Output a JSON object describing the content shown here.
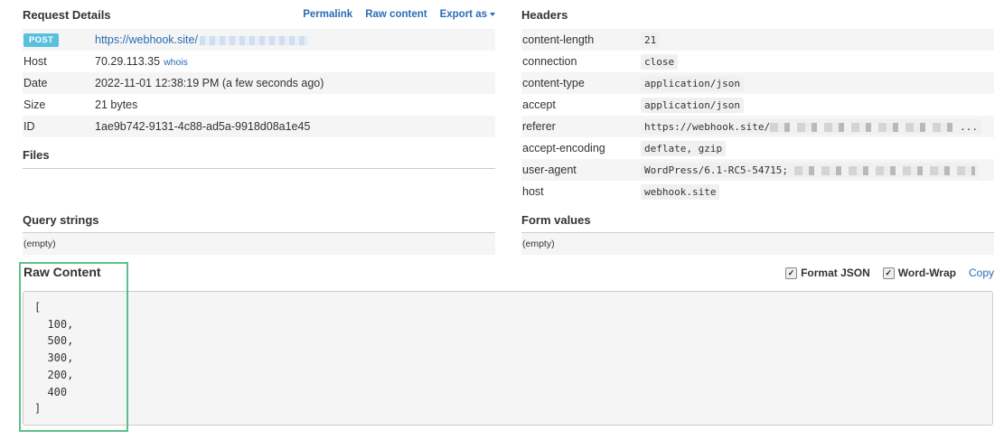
{
  "request": {
    "title": "Request Details",
    "links": {
      "permalink": "Permalink",
      "raw": "Raw content",
      "export": "Export as"
    },
    "method": "POST",
    "url": "https://webhook.site/",
    "rows": [
      {
        "key": "Host",
        "value": "70.29.113.35",
        "extra": "whois"
      },
      {
        "key": "Date",
        "value": "2022-11-01 12:38:19 PM (a few seconds ago)"
      },
      {
        "key": "Size",
        "value": "21 bytes"
      },
      {
        "key": "ID",
        "value": "1ae9b742-9131-4c88-ad5a-9918d08a1e45"
      }
    ]
  },
  "files": {
    "title": "Files"
  },
  "query": {
    "title": "Query strings",
    "value": "(empty)"
  },
  "headers": {
    "title": "Headers",
    "rows": [
      {
        "key": "content-length",
        "value": "21"
      },
      {
        "key": "connection",
        "value": "close"
      },
      {
        "key": "content-type",
        "value": "application/json"
      },
      {
        "key": "accept",
        "value": "application/json"
      },
      {
        "key": "referer",
        "value": "https://webhook.site/",
        "tail": "..."
      },
      {
        "key": "accept-encoding",
        "value": "deflate, gzip"
      },
      {
        "key": "user-agent",
        "value": "WordPress/6.1-RC5-54715;"
      },
      {
        "key": "host",
        "value": "webhook.site"
      }
    ]
  },
  "form": {
    "title": "Form values",
    "value": "(empty)"
  },
  "raw": {
    "title": "Raw Content",
    "format_json": "Format JSON",
    "word_wrap": "Word-Wrap",
    "copy": "Copy",
    "content": "[\n  100,\n  500,\n  300,\n  200,\n  400\n]"
  },
  "colors": {
    "link": "#2a6cb5",
    "badge": "#5bc0de",
    "highlight": "#5cc08e"
  }
}
